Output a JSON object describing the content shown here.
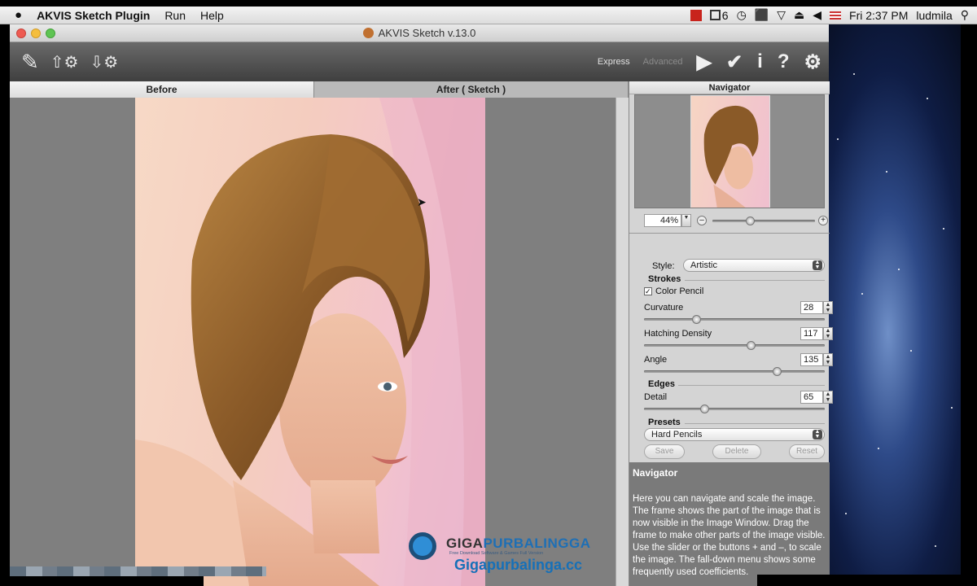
{
  "menubar": {
    "apple": "",
    "app_name": "AKVIS Sketch Plugin",
    "menus": [
      "Run",
      "Help"
    ],
    "status": {
      "badge": "6",
      "clock": "Fri 2:37 PM",
      "user": "ludmila"
    }
  },
  "window": {
    "title": "AKVIS Sketch v.13.0"
  },
  "toolbar": {
    "modes": [
      "Express",
      "Advanced"
    ],
    "colors": {
      "express": "#e0e0e0",
      "advanced": "#8a8a8a"
    }
  },
  "tabs": [
    {
      "label": "Before"
    },
    {
      "label": "After ( Sketch )"
    }
  ],
  "navigator": {
    "title": "Navigator",
    "zoom": "44%"
  },
  "settings": {
    "style_label": "Style:",
    "style_value": "Artistic",
    "strokes_title": "Strokes",
    "color_pencil": "Color Pencil",
    "color_pencil_checked": true,
    "params": [
      {
        "label": "Curvature",
        "value": "28",
        "fraction": 0.28
      },
      {
        "label": "Hatching Density",
        "value": "117",
        "fraction": 0.6
      },
      {
        "label": "Angle",
        "value": "135",
        "fraction": 0.75
      }
    ],
    "edges_title": "Edges",
    "detail": {
      "label": "Detail",
      "value": "65",
      "fraction": 0.33
    },
    "presets_title": "Presets",
    "preset_value": "Hard Pencils",
    "buttons": [
      "Save",
      "Delete",
      "Reset"
    ]
  },
  "help": {
    "title": "Navigator",
    "body": "Here you can navigate and scale the image. The frame shows the part of the image that is now visible in the Image Window. Drag the frame to make other parts of the image visible. Use the slider or the buttons + and –, to scale the image. The fall-down menu shows some frequently used coefficients."
  },
  "watermark": {
    "brand_a": "GIGA",
    "brand_b": "PURBALINGGA",
    "tagline": "Free Download Software & Games Full Version",
    "url": "Gigapurbalinga.cc"
  }
}
